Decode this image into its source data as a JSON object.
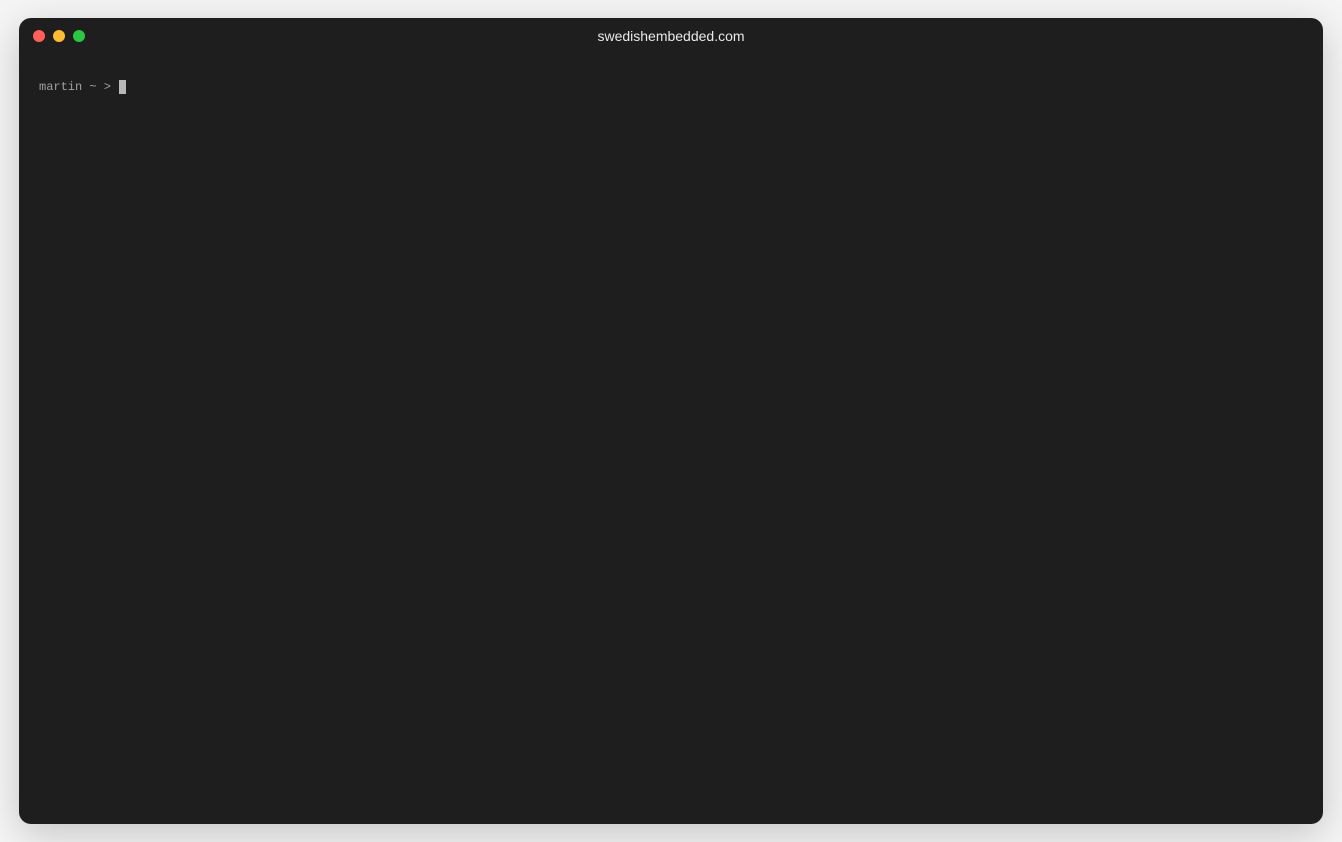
{
  "window": {
    "title": "swedishembedded.com"
  },
  "terminal": {
    "prompt": "martin ~ > "
  }
}
